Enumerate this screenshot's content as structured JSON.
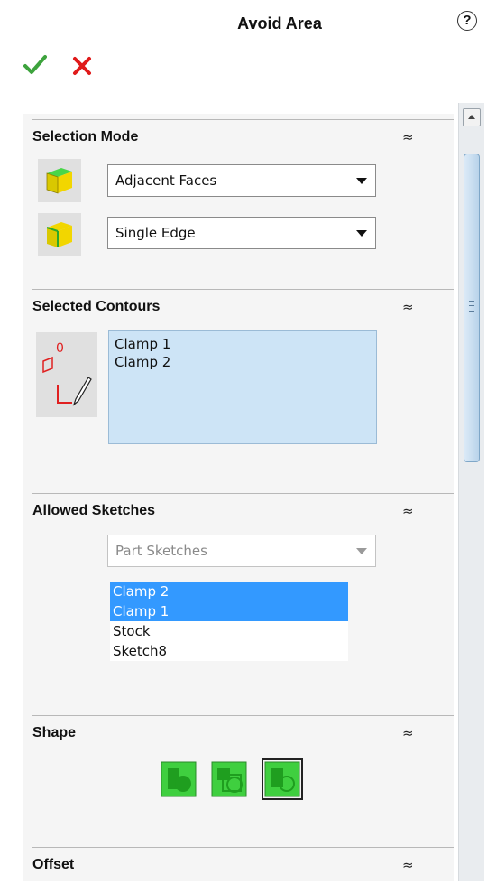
{
  "header": {
    "title": "Avoid Area",
    "help_icon": "?"
  },
  "selection_mode": {
    "title": "Selection Mode",
    "dropdown1": "Adjacent Faces",
    "dropdown2": "Single Edge"
  },
  "selected_contours": {
    "title": "Selected Contours",
    "items": [
      "Clamp 1",
      "Clamp 2"
    ]
  },
  "allowed_sketches": {
    "title": "Allowed Sketches",
    "dropdown": "Part Sketches",
    "items": [
      "Clamp 2",
      "Clamp 1",
      "Stock",
      "Sketch8"
    ]
  },
  "shape": {
    "title": "Shape"
  },
  "offset": {
    "title": "Offset"
  },
  "colors": {
    "accent_green": "#3da33d",
    "cancel_red": "#e01a1a",
    "selection": "#3399ff"
  }
}
